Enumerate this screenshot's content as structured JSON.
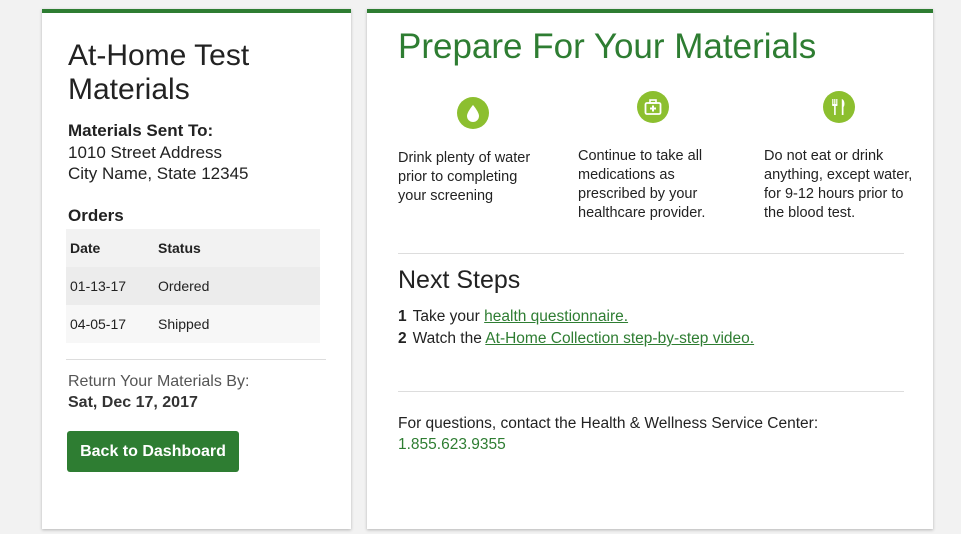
{
  "left_panel": {
    "title": "At-Home Test Materials",
    "sent_to_label": "Materials Sent To:",
    "address_line1": "1010 Street Address",
    "address_line2": "City Name, State 12345",
    "orders_label": "Orders",
    "orders_table": {
      "headers": [
        "Date",
        "Status"
      ],
      "rows": [
        {
          "date": "01-13-17",
          "status": "Ordered"
        },
        {
          "date": "04-05-17",
          "status": "Shipped"
        }
      ]
    },
    "return_label": "Return Your Materials By:",
    "return_date": "Sat, Dec 17, 2017",
    "back_button": "Back to Dashboard"
  },
  "right_panel": {
    "title": "Prepare For Your Materials",
    "tips": [
      {
        "icon": "water-drop-icon",
        "text": "Drink plenty of water prior to completing your screening"
      },
      {
        "icon": "medical-kit-icon",
        "text": "Continue to take all medications as prescribed by your healthcare provider."
      },
      {
        "icon": "fork-knife-icon",
        "text": "Do not eat or drink anything, except water, for 9-12 hours prior to the blood test."
      }
    ],
    "next_steps_title": "Next Steps",
    "steps": [
      {
        "number": "1",
        "prefix": "Take your",
        "link": "health questionnaire."
      },
      {
        "number": "2",
        "prefix": "Watch the",
        "link": "At-Home Collection step-by-step video."
      }
    ],
    "contact_text": "For questions, contact the Health & Wellness Service Center:",
    "contact_phone": "1.855.623.9355"
  },
  "colors": {
    "brand_green": "#2e7d32",
    "icon_green": "#8cbf2f"
  }
}
